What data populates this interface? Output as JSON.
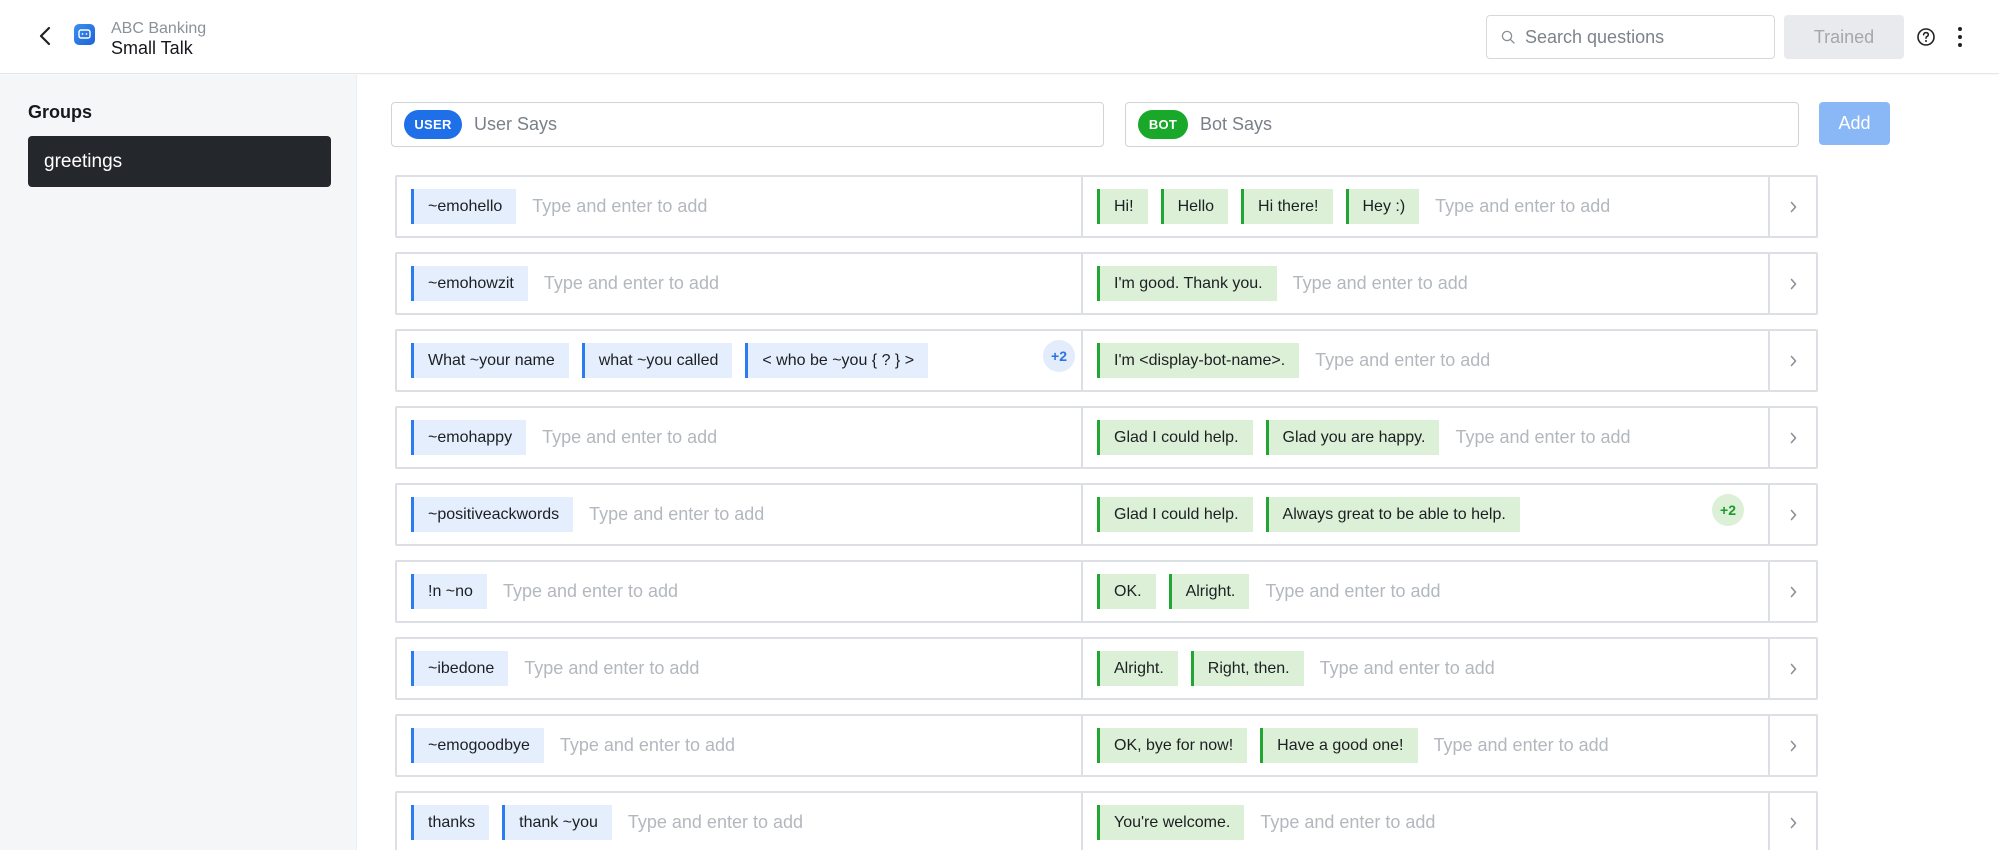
{
  "header": {
    "app_sub": "ABC Banking",
    "app_title": "Small Talk",
    "search_placeholder": "Search questions",
    "trained_label": "Trained"
  },
  "sidebar": {
    "title": "Groups",
    "items": [
      {
        "label": "greetings",
        "selected": true
      }
    ]
  },
  "composer": {
    "user_badge": "USER",
    "user_placeholder": "User Says",
    "bot_badge": "BOT",
    "bot_placeholder": "Bot Says",
    "add_label": "Add"
  },
  "add_placeholder": "Type and enter to add",
  "rows": [
    {
      "user": [
        "~emohello"
      ],
      "user_more": "",
      "bot": [
        "Hi!",
        "Hello",
        "Hi there!",
        "Hey :)"
      ],
      "bot_more": ""
    },
    {
      "user": [
        "~emohowzit"
      ],
      "user_more": "",
      "bot": [
        "I'm good. Thank you."
      ],
      "bot_more": ""
    },
    {
      "user": [
        "What ~your name",
        "what ~you called",
        "< who be ~you { ? } >"
      ],
      "user_more": "+2",
      "bot": [
        "I'm <display-bot-name>."
      ],
      "bot_more": ""
    },
    {
      "user": [
        "~emohappy"
      ],
      "user_more": "",
      "bot": [
        "Glad I could help.",
        "Glad you are happy."
      ],
      "bot_more": ""
    },
    {
      "user": [
        "~positiveackwords"
      ],
      "user_more": "",
      "bot": [
        "Glad I could help.",
        "Always great to be able to help."
      ],
      "bot_more": "+2"
    },
    {
      "user": [
        "!n ~no"
      ],
      "user_more": "",
      "bot": [
        "OK.",
        "Alright."
      ],
      "bot_more": ""
    },
    {
      "user": [
        "~ibedone"
      ],
      "user_more": "",
      "bot": [
        "Alright.",
        "Right, then."
      ],
      "bot_more": ""
    },
    {
      "user": [
        "~emogoodbye"
      ],
      "user_more": "",
      "bot": [
        "OK, bye for now!",
        "Have a good one!"
      ],
      "bot_more": ""
    },
    {
      "user": [
        "thanks",
        "thank ~you"
      ],
      "user_more": "",
      "bot": [
        "You're welcome."
      ],
      "bot_more": ""
    }
  ],
  "colors": {
    "accent": "#1e6fe8",
    "bot_green": "#19a82a",
    "selected_group_bg": "#24272c"
  }
}
